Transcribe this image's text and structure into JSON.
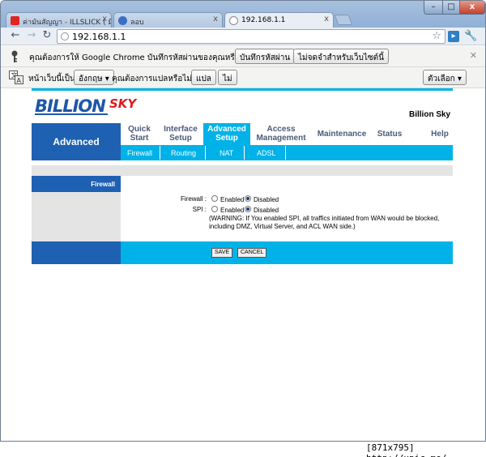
{
  "browser": {
    "tabs": [
      {
        "title": "ค่ามันสัญญา - ILLSLICK ( มีแน้",
        "favicon_color": "#e02424"
      },
      {
        "title": "ลอบ",
        "favicon_color": "#3b6fc4"
      },
      {
        "title": "192.168.1.1",
        "favicon_color": "#888888"
      }
    ],
    "url": "192.168.1.1",
    "window_buttons": {
      "minimize": "–",
      "maximize": "□",
      "close": "x"
    }
  },
  "password_bar": {
    "message": "คุณต้องการให้ Google Chrome บันทึกรหัสผ่านของคุณหรือไม่",
    "save_label": "บันทึกรหัสผ่าน",
    "never_label": "ไม่จดจำสำหรับเว็บไซต์นี้"
  },
  "translate_bar": {
    "prefix": "หน้าเว็บนี้เป็น",
    "language": "อังกฤษ",
    "question": "คุณต้องการแปลหรือไม่",
    "translate_label": "แปล",
    "no_label": "ไม่",
    "options_label": "ตัวเลือก"
  },
  "router": {
    "logo_main": "BILLION",
    "logo_accent": "SKY",
    "brand_name": "Billion Sky",
    "section": "Advanced",
    "nav": [
      {
        "line1": "Quick",
        "line2": "Start"
      },
      {
        "line1": "Interface",
        "line2": "Setup"
      },
      {
        "line1": "Advanced",
        "line2": "Setup"
      },
      {
        "line1": "Access",
        "line2": "Management"
      },
      {
        "line1": "Maintenance",
        "line2": ""
      },
      {
        "line1": "Status",
        "line2": ""
      },
      {
        "line1": "Help",
        "line2": ""
      }
    ],
    "subnav": [
      "Firewall",
      "Routing",
      "NAT",
      "ADSL"
    ],
    "panel_title": "Firewall",
    "fields": {
      "firewall_label": "Firewall :",
      "spi_label": "SPI :",
      "enabled": "Enabled",
      "disabled": "Disabled"
    },
    "warning": "(WARNING: If You enabled SPI, all traffics initiated from WAN would be blocked, including DMZ, Virtual Server, and ACL WAN side.)",
    "save_label": "SAVE",
    "cancel_label": "CANCEL"
  },
  "watermark": "[871x795] http://upic.me/",
  "colors": {
    "router_blue": "#1e61b3",
    "router_cyan": "#00b2e8",
    "logo_red": "#e0191b"
  }
}
